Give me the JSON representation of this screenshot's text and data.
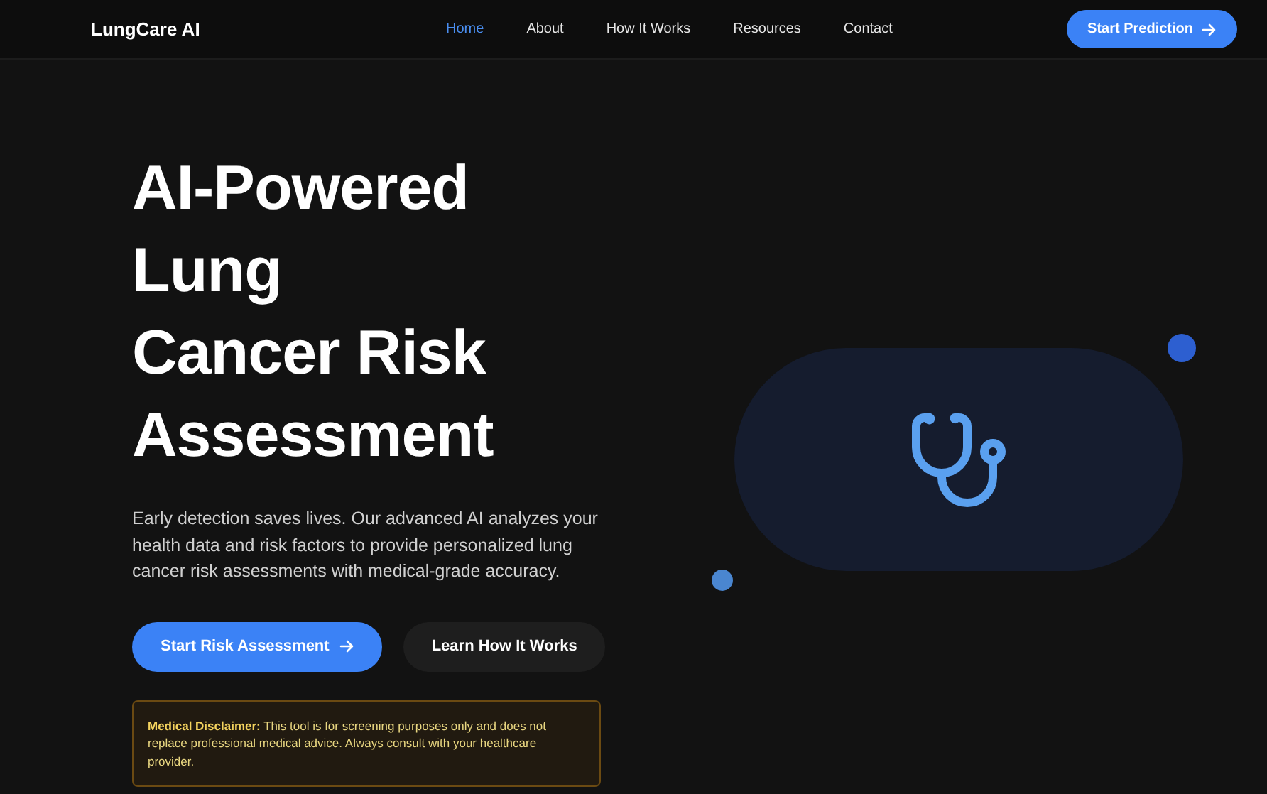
{
  "nav": {
    "logo": "LungCare AI",
    "links": [
      {
        "label": "Home",
        "selected": true
      },
      {
        "label": "About",
        "selected": false
      },
      {
        "label": "How It Works",
        "selected": false
      },
      {
        "label": "Resources",
        "selected": false
      },
      {
        "label": "Contact",
        "selected": false
      }
    ],
    "cta": "Start Prediction"
  },
  "hero": {
    "title_lines": [
      "AI-Powered",
      "Lung",
      "Cancer Risk",
      "Assessment"
    ],
    "description": "Early detection saves lives. Our advanced AI analyzes your health data and risk factors to provide personalized lung cancer risk assessments with medical-grade accuracy.",
    "primary_button": "Start Risk Assessment",
    "secondary_button": "Learn How It Works",
    "disclaimer": "**Medical Disclaimer:** This tool is for screening purposes only and does not replace professional medical advice. Always consult with your healthcare provider."
  }
}
